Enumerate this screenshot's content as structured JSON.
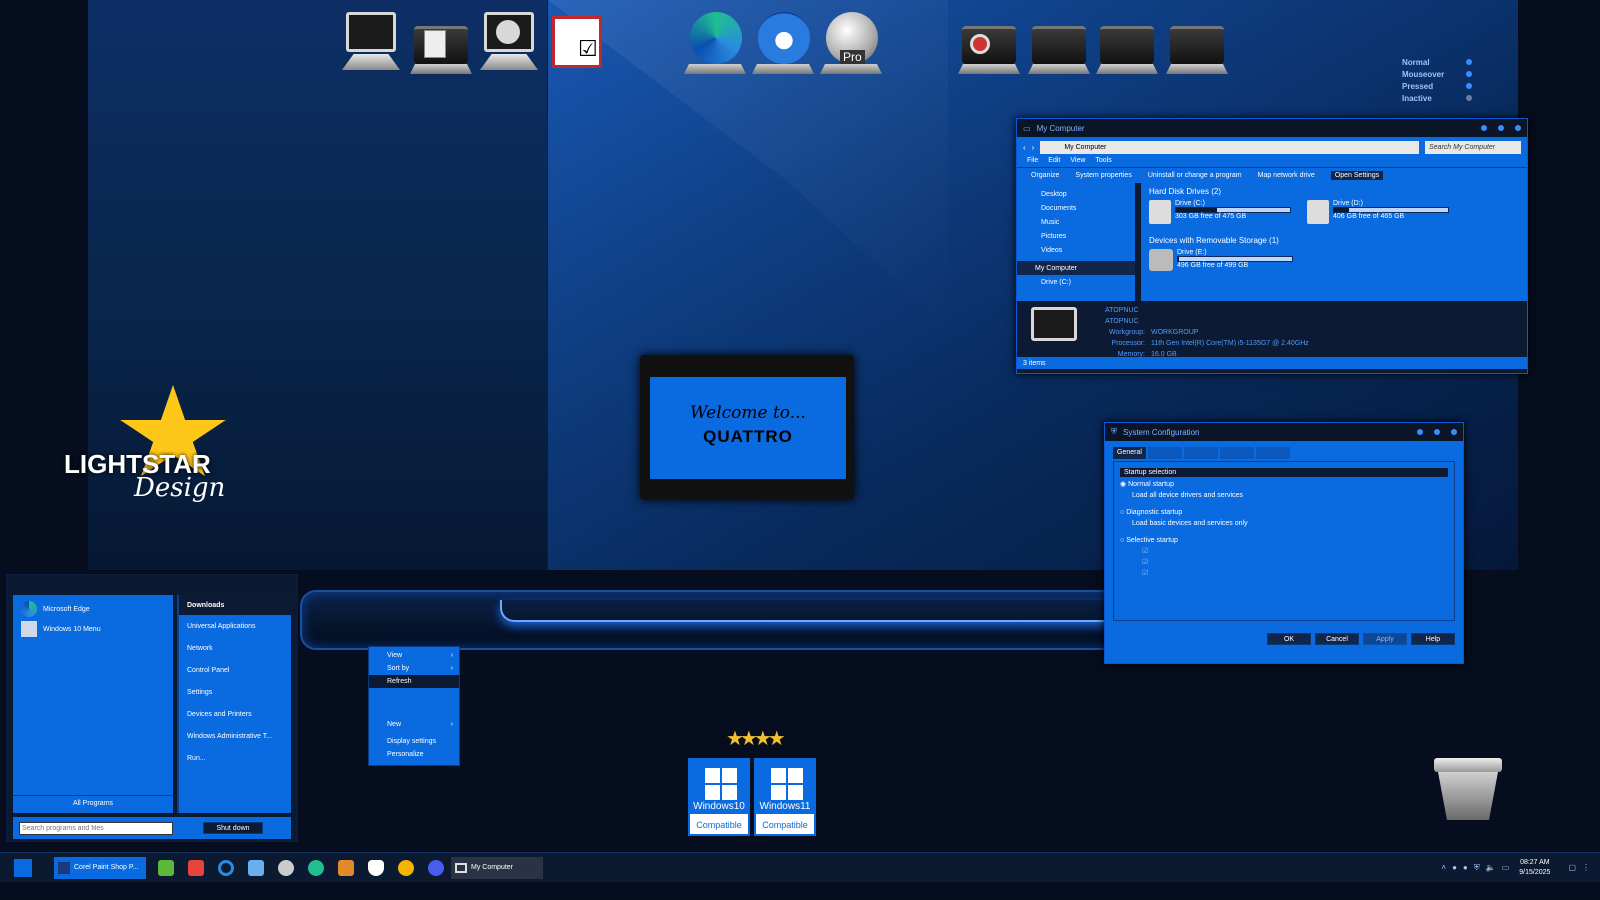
{
  "desktop": {
    "welcome_line1": "Welcome to...",
    "welcome_line2": "QUATTRO",
    "logo_text1": "LIGHTSTAR",
    "logo_text2": "Design"
  },
  "legend": [
    {
      "label": "Normal"
    },
    {
      "label": "Mouseover"
    },
    {
      "label": "Pressed"
    },
    {
      "label": "Inactive"
    }
  ],
  "desktop_icons": {
    "edge_badge": "Pro"
  },
  "my_computer": {
    "title": "My Computer",
    "address": "My Computer",
    "search": "Search My Computer",
    "menu": [
      "File",
      "Edit",
      "View",
      "Tools"
    ],
    "toolbar": [
      "Organize",
      "System properties",
      "Uninstall or change a program",
      "Map network drive",
      "Open Settings"
    ],
    "nav": [
      "Desktop",
      "Documents",
      "Music",
      "Pictures",
      "Videos",
      "My Computer",
      "Drive (C:)"
    ],
    "group1": "Hard Disk Drives (2)",
    "drive_c": {
      "name": "Drive (C:)",
      "free": "303 GB free of 475 GB",
      "used_pct": 36
    },
    "drive_d": {
      "name": "Drive (D:)",
      "free": "406 GB free of 465 GB",
      "used_pct": 13
    },
    "group2": "Devices with Removable Storage (1)",
    "drive_e": {
      "name": "Drive (E:)",
      "free": "496 GB free of 499 GB",
      "used_pct": 1
    },
    "details": {
      "name1": "ATOPNUC",
      "name2": "ATOPNUC",
      "workgroup_label": "Workgroup:",
      "workgroup": "WORKGROUP",
      "processor_label": "Processor:",
      "processor": "11th Gen Intel(R) Core(TM) i5-1135G7 @ 2.40GHz",
      "memory_label": "Memory:",
      "memory": "16.0 GB"
    },
    "status": "3 items"
  },
  "sysconf": {
    "title": "System Configuration",
    "tab_active": "General",
    "section": "Startup selection",
    "opt1": "Normal startup",
    "opt1_desc": "Load all device drivers and services",
    "opt2": "Diagnostic startup",
    "opt2_desc": "Load basic devices and services only",
    "opt3": "Selective startup",
    "buttons": [
      "OK",
      "Cancel",
      "Apply",
      "Help"
    ]
  },
  "start_menu": {
    "pinned": [
      "Microsoft Edge",
      "Windows 10 Menu"
    ],
    "all_programs": "All Programs",
    "search_placeholder": "Search programs and files",
    "shutdown": "Shut down",
    "right": [
      "Downloads",
      "Universal Applications",
      "Network",
      "Control Panel",
      "Settings",
      "Devices and Printers",
      "Windows Administrative T...",
      "Run..."
    ]
  },
  "context_menu": [
    "View",
    "Sort by",
    "Refresh",
    "New",
    "Display settings",
    "Personalize"
  ],
  "badges": {
    "win10": "Windows10",
    "win11": "Windows11",
    "compatible": "Compatible"
  },
  "taskbar": {
    "app1": "Corel Paint Shop P...",
    "app2": "My Computer",
    "time": "08:27 AM",
    "date": "9/15/2025"
  },
  "colors": {
    "accent": "#0a6ae0",
    "dark": "#0c1a33",
    "highlight": "#3b8cff"
  }
}
